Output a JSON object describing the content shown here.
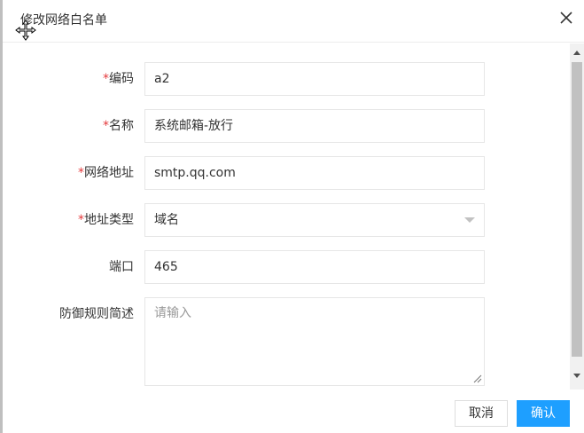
{
  "dialog": {
    "title": "修改网络白名单"
  },
  "form": {
    "code": {
      "label": "编码",
      "value": "a2",
      "required": "*"
    },
    "name": {
      "label": "名称",
      "value": "系统邮箱-放行",
      "required": "*"
    },
    "address": {
      "label": "网络地址",
      "value": "smtp.qq.com",
      "required": "*"
    },
    "addr_type": {
      "label": "地址类型",
      "value": "域名",
      "required": "*"
    },
    "port": {
      "label": "端口",
      "value": "465"
    },
    "desc": {
      "label": "防御规则简述",
      "placeholder": "请输入"
    }
  },
  "footer": {
    "cancel_label": "取消",
    "ok_label": "确认"
  },
  "colors": {
    "primary": "#1e9fff",
    "required": "#e4393c",
    "border": "#e6e6e6"
  },
  "icons": [
    "move-cursor-icon",
    "close-icon",
    "chevron-down-icon",
    "resize-handle-icon",
    "scroll-up-arrow-icon",
    "scroll-down-arrow-icon"
  ]
}
